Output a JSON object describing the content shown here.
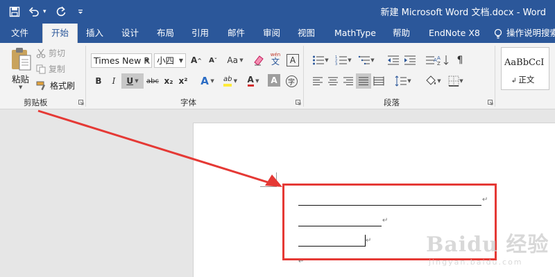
{
  "window": {
    "title": "新建 Microsoft Word 文档.docx - Word"
  },
  "quick_access": {
    "items": [
      "save-icon",
      "undo-icon",
      "redo-icon",
      "customize-icon"
    ]
  },
  "tabs": [
    {
      "label": "文件",
      "active": false
    },
    {
      "label": "开始",
      "active": true
    },
    {
      "label": "插入",
      "active": false
    },
    {
      "label": "设计",
      "active": false
    },
    {
      "label": "布局",
      "active": false
    },
    {
      "label": "引用",
      "active": false
    },
    {
      "label": "邮件",
      "active": false
    },
    {
      "label": "审阅",
      "active": false
    },
    {
      "label": "视图",
      "active": false
    },
    {
      "label": "MathType",
      "active": false
    },
    {
      "label": "帮助",
      "active": false
    },
    {
      "label": "EndNote X8",
      "active": false
    }
  ],
  "tell_me": {
    "label": "操作说明搜索"
  },
  "clipboard": {
    "group_label": "剪贴板",
    "paste_label": "粘贴",
    "cut_label": "剪切",
    "copy_label": "复制",
    "format_painter_label": "格式刷"
  },
  "font": {
    "group_label": "字体",
    "font_name": "Times New R",
    "font_size": "小四",
    "change_case": "Aa",
    "phonetic_top": "wén",
    "phonetic_bottom": "文",
    "char_border": "A",
    "bold": "B",
    "italic": "I",
    "underline": "U",
    "strikethrough": "abc",
    "subscript": "x₂",
    "superscript": "x²",
    "effects": "A",
    "highlight": "ab",
    "font_color": "A",
    "shading": "A",
    "enclose": "字"
  },
  "paragraph": {
    "group_label": "段落"
  },
  "styles": {
    "sample": "AaBbCcI",
    "normal_label": "正文"
  },
  "document": {
    "paragraph_mark": "↵"
  },
  "watermark": {
    "brand": "Baidu 经验",
    "url": "jingyan.baidu.com"
  },
  "colors": {
    "word_blue": "#2b579a",
    "ribbon_bg": "#f3f3f3",
    "annotation_red": "#e53935",
    "highlight_yellow": "#ffeb3b",
    "font_red": "#d32f2f"
  }
}
